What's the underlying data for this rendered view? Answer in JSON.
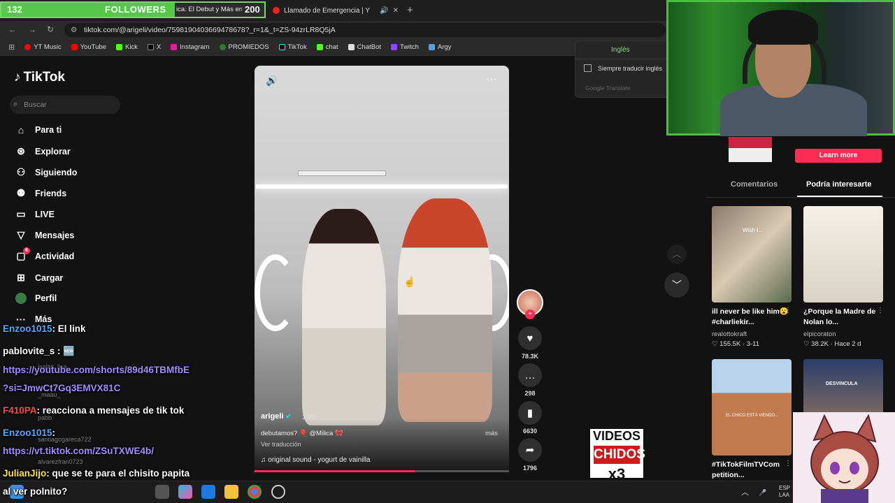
{
  "browser": {
    "tab_prev": "ica: El Debut y Más en e",
    "tab_active": "Llamado de Emergencia | Y",
    "url": "tiktok.com/@arigeli/video/7598190403669478678?_r=1&_t=ZS-94zrLR8Q5jA",
    "bookmarks": [
      "YT Music",
      "YouTube",
      "Kick",
      "X",
      "Instagram",
      "PROMIEDOS",
      "TikTok",
      "chat",
      "ChatBot",
      "Twitch",
      "Argy"
    ]
  },
  "followers": {
    "count": "132",
    "label": "FOLLOWERS",
    "goal": "200",
    "progress": 0.66
  },
  "translate": {
    "language": "Inglés",
    "always": "Siempre traducir inglés",
    "brand": "Google Translate"
  },
  "tiktok": {
    "logo": "TikTok",
    "search_placeholder": "Buscar",
    "nav": [
      "Para ti",
      "Explorar",
      "Siguiendo",
      "Friends",
      "LIVE",
      "Mensajes",
      "Actividad",
      "Cargar",
      "Perfil",
      "Más"
    ],
    "activity_badge": "6"
  },
  "video": {
    "author": "arigeli",
    "date": "1-22",
    "caption": "debutamos? 🎈 @Milica 🎀",
    "more": "más",
    "translate": "Ver traducción",
    "sound": "original sound - yogurt de vainilla",
    "progress": 0.63,
    "likes": "78.3K",
    "comments": "298",
    "saves": "6630",
    "shares": "1796"
  },
  "right_panel": {
    "learn_more": "Learn more",
    "tab_comments": "Comentarios",
    "tab_suggest": "Podría interesarte",
    "videos": [
      {
        "title": "ill never be like him😮 #charliekir...",
        "author": "realottokraft",
        "stats": "♡ 155.5K · 3-11",
        "thumb_text": "Wish I..."
      },
      {
        "title": "¿Porque la Madre de Nolan lo...",
        "author": "elpicoraton",
        "stats": "♡ 38.2K · Hace 2 d",
        "thumb_text": ""
      },
      {
        "title": "#TikTokFilmTVCom petition...",
        "author": "",
        "stats": "",
        "thumb_text": "EL CHICO ESTÁ VIENDO..."
      },
      {
        "title": "",
        "author": "",
        "stats": "",
        "thumb_text": "DESVINCULA"
      }
    ]
  },
  "chat": [
    {
      "user": "Enzoo1015",
      "msg": ": El link",
      "color": "#5aa7ff"
    },
    {
      "user": "pablovite_s",
      "msg": " : 🆕",
      "color": "#ffffff"
    },
    {
      "user": "",
      "msg": "https://youtube.com/shorts/89d46TBMfbE",
      "color": "#a18cff"
    },
    {
      "user": "",
      "msg": "?si=JmwCt7Gq3EMVX81C",
      "color": "#a18cff"
    },
    {
      "user": "F410PA",
      "msg": ": reacciona a mensajes de tik tok",
      "color": "#ff4a4a"
    },
    {
      "user": "Enzoo1015",
      "msg": ":",
      "color": "#5aa7ff"
    },
    {
      "user": "",
      "msg": "https://vt.tiktok.com/ZSuTXWE4b/",
      "color": "#a18cff"
    },
    {
      "user": "JulianJijo",
      "msg": ": que se te para el chisito papita",
      "color": "#ffe44d"
    },
    {
      "user": "",
      "msg": "al ver polnito?",
      "color": "#ffffff"
    }
  ],
  "chat_ghosts": [
    "isalas_lisa",
    "_maau_",
    "pabb",
    "santiagogareca722",
    "alvarezfran0723"
  ],
  "logos": {
    "vc_top": "VIDEOS",
    "vc_mid": "CHIDOS",
    "vc_bot": "x3"
  },
  "tray": {
    "lang": "ESP",
    "region": "LAA"
  }
}
